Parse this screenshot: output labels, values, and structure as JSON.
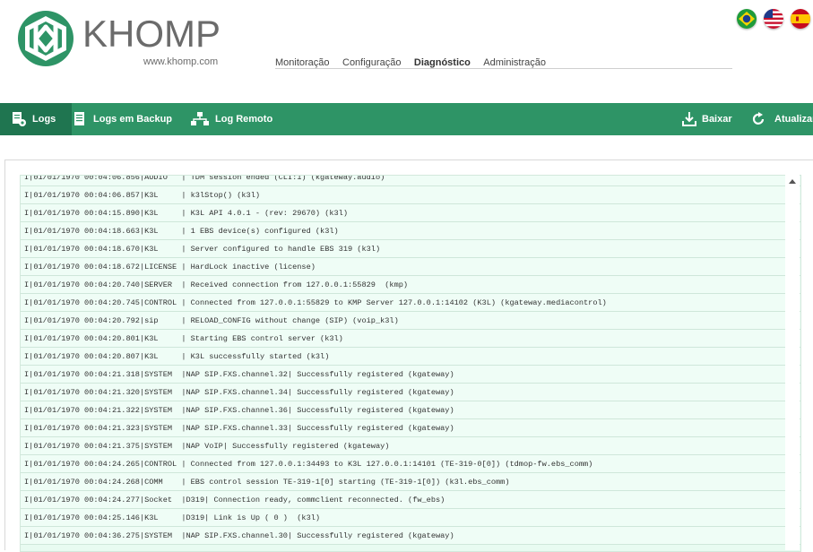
{
  "brand": {
    "name": "KHOMP",
    "url": "www.khomp.com"
  },
  "topnav": [
    {
      "label": "Monitoração",
      "active": false
    },
    {
      "label": "Configuração",
      "active": false
    },
    {
      "label": "Diagnóstico",
      "active": true
    },
    {
      "label": "Administração",
      "active": false
    }
  ],
  "flags": [
    "brazil-flag-icon",
    "usa-flag-icon",
    "spain-flag-icon"
  ],
  "toolbar": {
    "logs": "Logs",
    "backup": "Logs em Backup",
    "remote": "Log Remoto",
    "download": "Baixar",
    "refresh": "Atualizar"
  },
  "colors": {
    "toolbar": "#2e9466",
    "toolbar_active": "#1f7550",
    "log_bg": "#effdf6"
  },
  "log_lines": [
    "I|01/01/1970 00:04:06.856|AUDIO   | TDM session ended (CLI:1) (kgateway.audio)",
    "I|01/01/1970 00:04:06.857|K3L     | k3lStop() (k3l)",
    "I|01/01/1970 00:04:15.890|K3L     | K3L API 4.0.1 - (rev: 29670) (k3l)",
    "I|01/01/1970 00:04:18.663|K3L     | 1 EBS device(s) configured (k3l)",
    "I|01/01/1970 00:04:18.670|K3L     | Server configured to handle EBS 319 (k3l)",
    "I|01/01/1970 00:04:18.672|LICENSE | HardLock inactive (license)",
    "I|01/01/1970 00:04:20.740|SERVER  | Received connection from 127.0.0.1:55829  (kmp)",
    "I|01/01/1970 00:04:20.745|CONTROL | Connected from 127.0.0.1:55829 to KMP Server 127.0.0.1:14102 (K3L) (kgateway.mediacontrol)",
    "I|01/01/1970 00:04:20.792|sip     | RELOAD_CONFIG without change (SIP) (voip_k3l)",
    "I|01/01/1970 00:04:20.801|K3L     | Starting EBS control server (k3l)",
    "I|01/01/1970 00:04:20.807|K3L     | K3L successfully started (k3l)",
    "I|01/01/1970 00:04:21.318|SYSTEM  |NAP SIP.FXS.channel.32| Successfully registered (kgateway)",
    "I|01/01/1970 00:04:21.320|SYSTEM  |NAP SIP.FXS.channel.34| Successfully registered (kgateway)",
    "I|01/01/1970 00:04:21.322|SYSTEM  |NAP SIP.FXS.channel.36| Successfully registered (kgateway)",
    "I|01/01/1970 00:04:21.323|SYSTEM  |NAP SIP.FXS.channel.33| Successfully registered (kgateway)",
    "I|01/01/1970 00:04:21.375|SYSTEM  |NAP VoIP| Successfully registered (kgateway)",
    "I|01/01/1970 00:04:24.265|CONTROL | Connected from 127.0.0.1:34493 to K3L 127.0.0.1:14101 (TE-319-0[0]) (tdmop-fw.ebs_comm)",
    "I|01/01/1970 00:04:24.268|COMM    | EBS control session TE-319-1[0] starting (TE-319-1[0]) (k3l.ebs_comm)",
    "I|01/01/1970 00:04:24.277|Socket  |D319| Connection ready, commclient reconnected. (fw_ebs)",
    "I|01/01/1970 00:04:25.146|K3L     |D319| Link is Up ( 0 )  (k3l)",
    "I|01/01/1970 00:04:36.275|SYSTEM  |NAP SIP.FXS.channel.30| Successfully registered (kgateway)"
  ]
}
